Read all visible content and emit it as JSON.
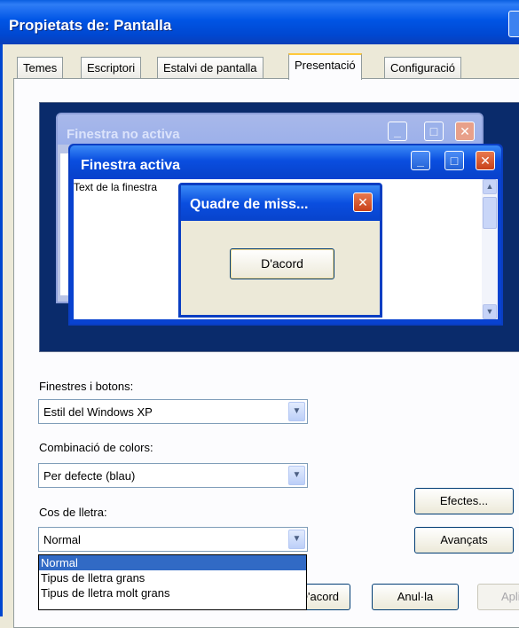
{
  "window": {
    "title": "Propietats de: Pantalla"
  },
  "tabs": [
    "Temes",
    "Escriptori",
    "Estalvi de pantalla",
    "Presentació",
    "Configuració"
  ],
  "active_tab": "Presentació",
  "preview": {
    "inactive_title": "Finestra no activa",
    "active_title": "Finestra activa",
    "window_text": "Text de la finestra",
    "msgbox_title": "Quadre de miss...",
    "msgbox_ok": "D'acord"
  },
  "form": {
    "windows_label": "Finestres i botons:",
    "windows_value": "Estil del Windows XP",
    "colors_label": "Combinació de colors:",
    "colors_value": "Per defecte (blau)",
    "font_label": "Cos de lletra:",
    "font_value": "Normal",
    "font_options": [
      "Normal",
      "Tipus de lletra grans",
      "Tipus de lletra molt grans"
    ]
  },
  "buttons": {
    "effects": "Efectes...",
    "advanced": "Avançats",
    "ok": "D'acord",
    "cancel": "Anul·la",
    "apply": "Aplica"
  },
  "colors": {
    "title_bar": "#0055e5",
    "selection": "#316ac5",
    "desktop": "#0a2b6b"
  }
}
